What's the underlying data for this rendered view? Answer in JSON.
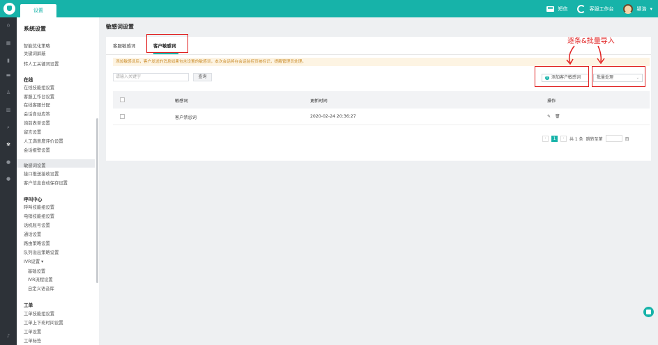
{
  "topbar": {
    "tab_label": "设置",
    "sms_label": "短信",
    "workspace_label": "客服工作台",
    "user_label": "颖浩"
  },
  "menu": {
    "title": "系统设置",
    "items": [
      {
        "label": "智能优化策略",
        "type": "item"
      },
      {
        "label": "关键词屏蔽",
        "type": "item"
      },
      {
        "label": "转人工关键词设置",
        "type": "item"
      },
      {
        "label": "在线",
        "type": "head"
      },
      {
        "label": "在线技能组设置",
        "type": "item"
      },
      {
        "label": "客服工作台设置",
        "type": "item"
      },
      {
        "label": "在线客服分配",
        "type": "item"
      },
      {
        "label": "会话自动应答",
        "type": "item"
      },
      {
        "label": "询前表单设置",
        "type": "item"
      },
      {
        "label": "留言设置",
        "type": "item"
      },
      {
        "label": "人工满意度评价设置",
        "type": "item"
      },
      {
        "label": "会话报警设置",
        "type": "item"
      },
      {
        "label": "敏感词设置",
        "type": "item"
      },
      {
        "label": "接口推送接收设置",
        "type": "item"
      },
      {
        "label": "客户信息自动保存设置",
        "type": "item"
      },
      {
        "label": "呼叫中心",
        "type": "head"
      },
      {
        "label": "呼叫技能组设置",
        "type": "item"
      },
      {
        "label": "电销技能组设置",
        "type": "item"
      },
      {
        "label": "话机账号设置",
        "type": "item"
      },
      {
        "label": "通话设置",
        "type": "item"
      },
      {
        "label": "路由策略设置",
        "type": "item"
      },
      {
        "label": "队列溢出策略设置",
        "type": "item"
      },
      {
        "label": "IVR设置 ▾",
        "type": "item"
      },
      {
        "label": "基础设置",
        "type": "sub"
      },
      {
        "label": "IVR流程设置",
        "type": "sub"
      },
      {
        "label": "自定义语音库",
        "type": "sub"
      },
      {
        "label": "工单",
        "type": "head"
      },
      {
        "label": "工单技能组设置",
        "type": "item"
      },
      {
        "label": "工单上下班时间设置",
        "type": "item"
      },
      {
        "label": "工单设置",
        "type": "item"
      },
      {
        "label": "工单标签",
        "type": "item"
      }
    ]
  },
  "page": {
    "title": "敏感词设置",
    "tabs": [
      "客服敏感词",
      "客户敏感词"
    ],
    "notice": "添加敏感词后，客户发送的消息如果包含设置的敏感词，本次会话将在会话监控页被标识，提醒管理员处理。",
    "search_placeholder": "请输入关键字",
    "search_button": "查询",
    "add_button": "添加客户敏感词",
    "batch_select": "批量处理",
    "table": {
      "headers": [
        "敏感词",
        "更新时间",
        "操作"
      ],
      "rows": [
        {
          "word": "客户禁忌词",
          "time": "2020-02-24 20:36:27"
        }
      ]
    },
    "pager": {
      "current": "1",
      "total_text": "共 1 条",
      "jump_text": "跳转至第",
      "page_suffix": "页"
    }
  },
  "annotation": {
    "text": "逐条&批量导入"
  },
  "colors": {
    "brand": "#17b3a9",
    "annotation": "#e02020",
    "notice_bg": "#fdf4e3"
  }
}
